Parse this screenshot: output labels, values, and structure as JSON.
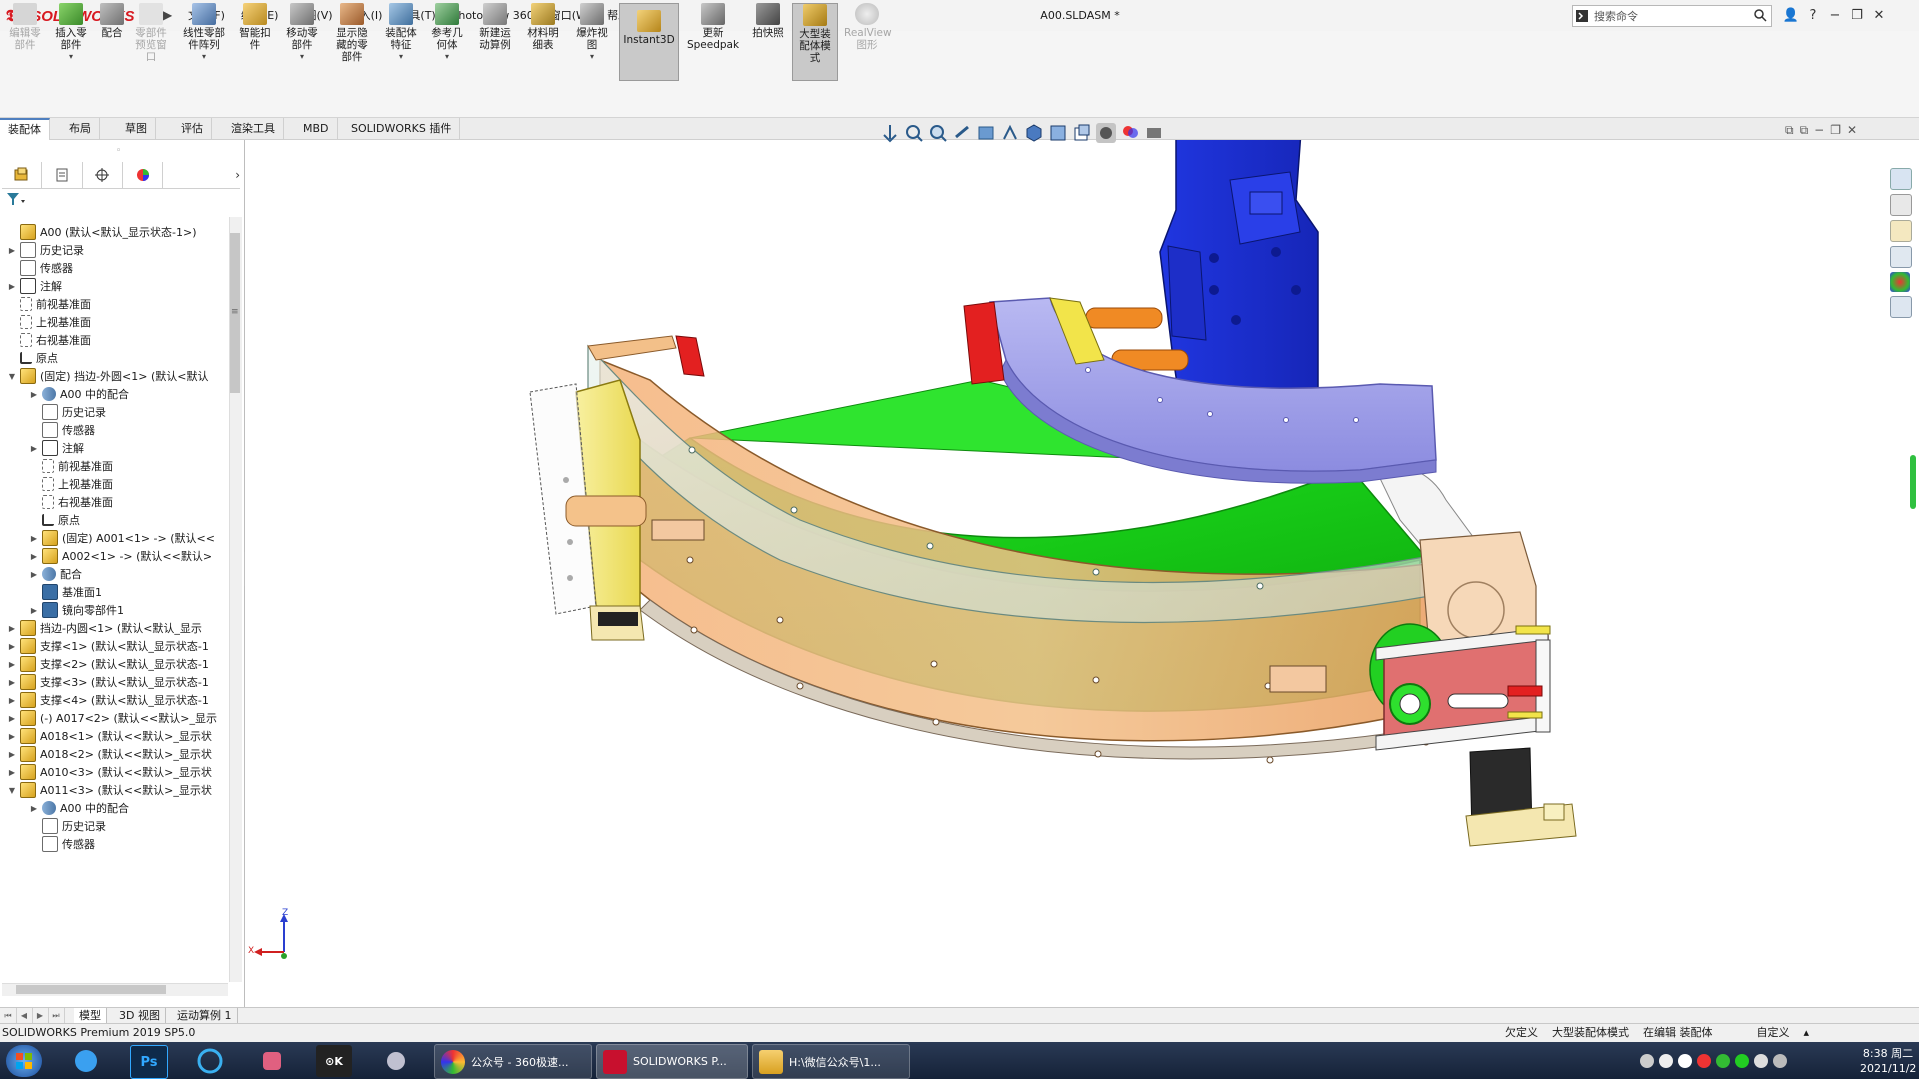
{
  "app": {
    "brand": "SOLIDWORKS",
    "document_title": "A00.SLDASM *",
    "search_placeholder": "搜索命令"
  },
  "menu": [
    "文件(F)",
    "编辑(E)",
    "视图(V)",
    "插入(I)",
    "工具(T)",
    "PhotoView 360",
    "窗口(W)",
    "帮助(H)"
  ],
  "toolbar": [
    {
      "label": "编辑零部件",
      "state": "disabled"
    },
    {
      "label": "插入零部件",
      "state": "normal"
    },
    {
      "label": "配合",
      "state": "normal"
    },
    {
      "label": "零部件预览窗口",
      "state": "disabled"
    },
    {
      "label": "线性零部件阵列",
      "state": "normal"
    },
    {
      "label": "智能扣件",
      "state": "normal"
    },
    {
      "label": "移动零部件",
      "state": "normal"
    },
    {
      "label": "显示隐藏的零部件",
      "state": "normal"
    },
    {
      "label": "装配体特征",
      "state": "normal"
    },
    {
      "label": "参考几何体",
      "state": "normal"
    },
    {
      "label": "新建运动算例",
      "state": "normal"
    },
    {
      "label": "材料明细表",
      "state": "normal"
    },
    {
      "label": "爆炸视图",
      "state": "normal"
    },
    {
      "label": "Instant3D",
      "state": "active"
    },
    {
      "label": "更新Speedpak",
      "state": "normal"
    },
    {
      "label": "拍快照",
      "state": "normal"
    },
    {
      "label": "大型装配体模式",
      "state": "active"
    },
    {
      "label": "RealView图形",
      "state": "disabled"
    }
  ],
  "tabs": [
    "装配体",
    "布局",
    "草图",
    "评估",
    "渲染工具",
    "MBD",
    "SOLIDWORKS 插件"
  ],
  "tree": [
    {
      "label": "A00  (默认<默认_显示状态-1>)",
      "icon": "asm",
      "level": 0,
      "arrow": ""
    },
    {
      "label": "历史记录",
      "icon": "fold",
      "level": 0,
      "arrow": "▶"
    },
    {
      "label": "传感器",
      "icon": "fold",
      "level": 0,
      "arrow": ""
    },
    {
      "label": "注解",
      "icon": "note",
      "level": 0,
      "arrow": "▶"
    },
    {
      "label": "前视基准面",
      "icon": "plane",
      "level": 0,
      "arrow": ""
    },
    {
      "label": "上视基准面",
      "icon": "plane",
      "level": 0,
      "arrow": ""
    },
    {
      "label": "右视基准面",
      "icon": "plane",
      "level": 0,
      "arrow": ""
    },
    {
      "label": "原点",
      "icon": "origin",
      "level": 0,
      "arrow": ""
    },
    {
      "label": "(固定) 挡边-外圆<1> (默认<默认",
      "icon": "asm",
      "level": 0,
      "arrow": "▼"
    },
    {
      "label": "A00 中的配合",
      "icon": "mate",
      "level": 1,
      "arrow": "▶"
    },
    {
      "label": "历史记录",
      "icon": "fold",
      "level": 1,
      "arrow": ""
    },
    {
      "label": "传感器",
      "icon": "fold",
      "level": 1,
      "arrow": ""
    },
    {
      "label": "注解",
      "icon": "note",
      "level": 1,
      "arrow": "▶"
    },
    {
      "label": "前视基准面",
      "icon": "plane",
      "level": 1,
      "arrow": ""
    },
    {
      "label": "上视基准面",
      "icon": "plane",
      "level": 1,
      "arrow": ""
    },
    {
      "label": "右视基准面",
      "icon": "plane",
      "level": 1,
      "arrow": ""
    },
    {
      "label": "原点",
      "icon": "origin",
      "level": 1,
      "arrow": ""
    },
    {
      "label": "(固定) A001<1> -> (默认<<",
      "icon": "asm",
      "level": 1,
      "arrow": "▶"
    },
    {
      "label": "A002<1> -> (默认<<默认>",
      "icon": "asm",
      "level": 1,
      "arrow": "▶"
    },
    {
      "label": "配合",
      "icon": "mate",
      "level": 1,
      "arrow": "▶"
    },
    {
      "label": "基准面1",
      "icon": "plane2",
      "level": 1,
      "arrow": ""
    },
    {
      "label": "镜向零部件1",
      "icon": "plane2",
      "level": 1,
      "arrow": "▶"
    },
    {
      "label": "挡边-内圆<1> (默认<默认_显示",
      "icon": "asm",
      "level": 0,
      "arrow": "▶"
    },
    {
      "label": "支撑<1> (默认<默认_显示状态-1",
      "icon": "asm",
      "level": 0,
      "arrow": "▶"
    },
    {
      "label": "支撑<2> (默认<默认_显示状态-1",
      "icon": "asm",
      "level": 0,
      "arrow": "▶"
    },
    {
      "label": "支撑<3> (默认<默认_显示状态-1",
      "icon": "asm",
      "level": 0,
      "arrow": "▶"
    },
    {
      "label": "支撑<4> (默认<默认_显示状态-1",
      "icon": "asm",
      "level": 0,
      "arrow": "▶"
    },
    {
      "label": "(-) A017<2> (默认<<默认>_显示",
      "icon": "asm",
      "level": 0,
      "arrow": "▶"
    },
    {
      "label": "A018<1> (默认<<默认>_显示状",
      "icon": "asm",
      "level": 0,
      "arrow": "▶"
    },
    {
      "label": "A018<2> (默认<<默认>_显示状",
      "icon": "asm",
      "level": 0,
      "arrow": "▶"
    },
    {
      "label": "A010<3> (默认<<默认>_显示状",
      "icon": "asm",
      "level": 0,
      "arrow": "▶"
    },
    {
      "label": "A011<3> (默认<<默认>_显示状",
      "icon": "asm",
      "level": 0,
      "arrow": "▼"
    },
    {
      "label": "A00 中的配合",
      "icon": "mate",
      "level": 1,
      "arrow": "▶"
    },
    {
      "label": "历史记录",
      "icon": "fold",
      "level": 1,
      "arrow": ""
    },
    {
      "label": "传感器",
      "icon": "fold",
      "level": 1,
      "arrow": ""
    }
  ],
  "bottom_tabs": [
    "模型",
    "3D 视图",
    "运动算例 1"
  ],
  "status": {
    "left": "SOLIDWORKS Premium 2019 SP5.0",
    "right": [
      "欠定义",
      "大型装配体模式",
      "在编辑 装配体",
      "自定义"
    ]
  },
  "triad": {
    "x": "X",
    "z": "Z"
  },
  "taskbar": {
    "windows": [
      "公众号 - 360极速...",
      "SOLIDWORKS P...",
      "H:\\微信公众号\\1..."
    ],
    "time": "8:38 周二",
    "date": "2021/11/2"
  },
  "colors": {
    "brand_red": "#d71920",
    "part_green": "#1ed11e",
    "part_orange": "#f0a56a",
    "part_blue": "#1a2fd6",
    "part_lavender": "#9f9fe8",
    "part_yellow": "#f2e44a",
    "part_red": "#e32020"
  }
}
